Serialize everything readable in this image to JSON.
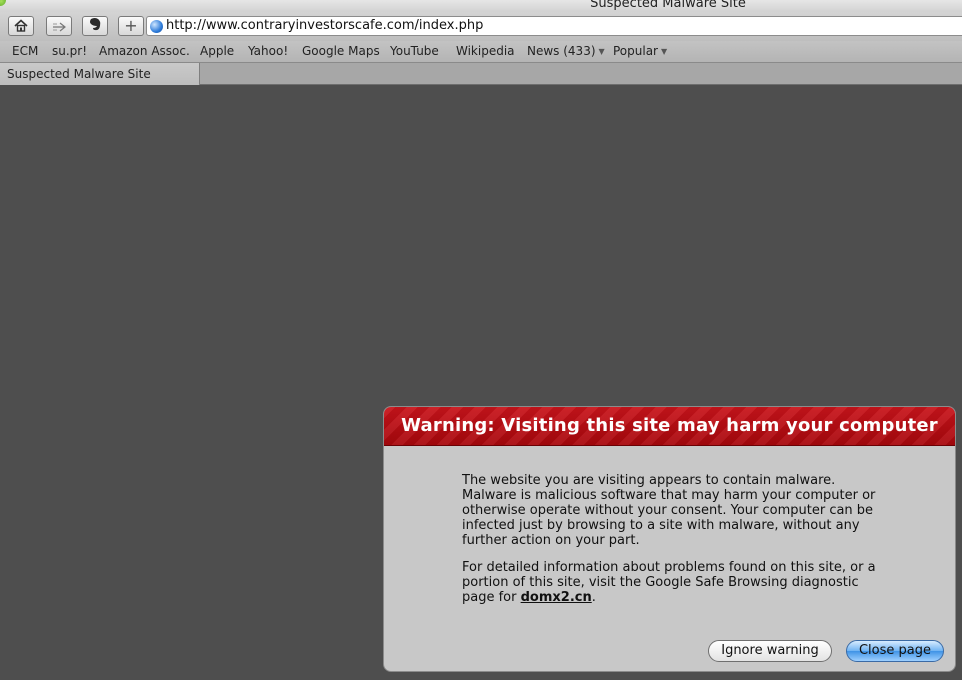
{
  "window": {
    "title": "Suspected Malware Site"
  },
  "toolbar": {
    "buttons": [
      {
        "name": "home-icon"
      },
      {
        "name": "snapback-icon"
      },
      {
        "name": "evernote-icon"
      },
      {
        "name": "add-bookmark-icon"
      }
    ],
    "add_label": "+",
    "address": {
      "url": "http://www.contraryinvestorscafe.com/index.php"
    }
  },
  "bookmarks": [
    {
      "label": "ECM"
    },
    {
      "label": "su.pr!"
    },
    {
      "label": "Amazon Assoc."
    },
    {
      "label": "Apple"
    },
    {
      "label": "Yahoo!"
    },
    {
      "label": "Google Maps"
    },
    {
      "label": "YouTube"
    },
    {
      "label": "Wikipedia"
    },
    {
      "label": "News (433)",
      "dropdown": true
    },
    {
      "label": "Popular",
      "dropdown": true
    }
  ],
  "tabs": [
    {
      "label": "Suspected Malware Site",
      "active": true
    }
  ],
  "warning": {
    "heading": "Warning: Visiting this site may harm your computer",
    "paragraph1": "The website you are visiting appears to contain malware. Malware is malicious software that may harm your computer or otherwise operate without your consent. Your computer can be infected just by browsing to a site with malware, without any further action on your part.",
    "paragraph2_prefix": "For detailed information about problems found on this site, or a portion of this site, visit the Google Safe Browsing diagnostic page for",
    "diagnostic_domain": "domx2.cn",
    "paragraph2_suffix": ".",
    "ignore_label": "Ignore warning",
    "close_label": "Close page"
  },
  "colors": {
    "background": "#4e4e4e",
    "warning_red": "#b80d13",
    "primary_button": "#5aa6ee"
  }
}
